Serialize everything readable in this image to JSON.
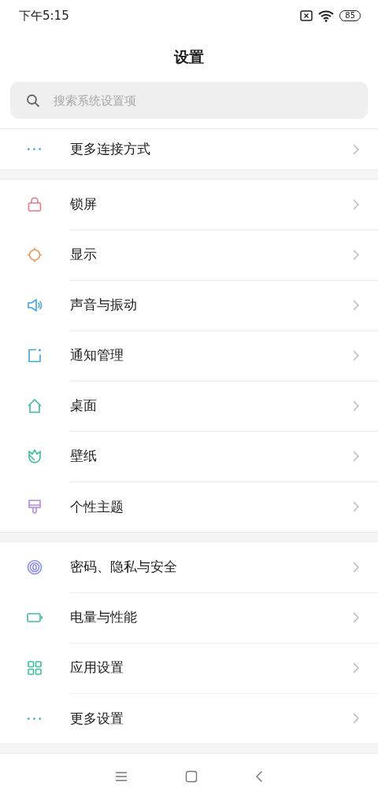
{
  "status_bar": {
    "time": "下午5:15",
    "battery": "85"
  },
  "title": "设置",
  "search": {
    "placeholder": "搜索系统设置项"
  },
  "groups": [
    {
      "items": [
        {
          "label": "更多连接方式"
        }
      ]
    },
    {
      "items": [
        {
          "label": "锁屏"
        },
        {
          "label": "显示"
        },
        {
          "label": "声音与振动"
        },
        {
          "label": "通知管理"
        },
        {
          "label": "桌面"
        },
        {
          "label": "壁纸"
        },
        {
          "label": "个性主题"
        }
      ]
    },
    {
      "items": [
        {
          "label": "密码、隐私与安全"
        },
        {
          "label": "电量与性能"
        },
        {
          "label": "应用设置"
        },
        {
          "label": "更多设置"
        }
      ]
    }
  ]
}
